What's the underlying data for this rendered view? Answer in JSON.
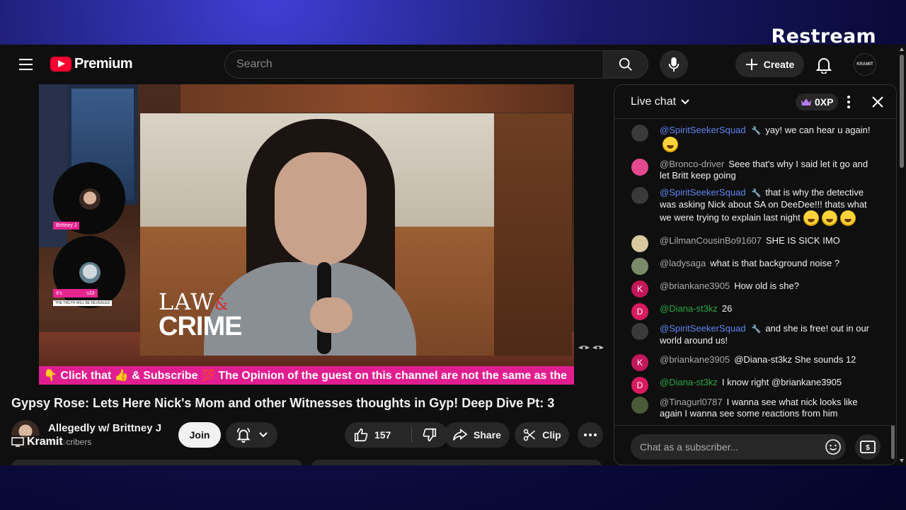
{
  "overlay": {
    "brand": "Restream"
  },
  "header": {
    "logo_text": "Premium",
    "search_placeholder": "Search",
    "create_label": "Create",
    "avatar_text": "KRAMIT"
  },
  "video": {
    "inset_logo_line1": "LAW",
    "inset_logo_amp": "&",
    "inset_logo_line2": "CRIME",
    "guest1_tag": "Brittney J",
    "guest2_tag": "It's ⠀⠀⠀⠀ ⠀⠀s33",
    "guest2_sub": "THE TRUTH WILL BE REVEALED",
    "ticker": "👇 Click that 👍 & Subscribe 💯 The Opinion of the guest on this channel are not the same as the"
  },
  "info": {
    "title": "Gypsy Rose: Lets Here Nick's Mom and other Witnesses thoughts in Gyp! Deep Dive Pt: 3",
    "channel_name": "Allegedly w/ Brittney J",
    "subscribers": "subscribers",
    "kramit_label": "Kramit",
    "join_label": "Join",
    "like_count": "157",
    "share_label": "Share",
    "clip_label": "Clip"
  },
  "chat": {
    "title": "Live chat",
    "xp": "0XP",
    "input_placeholder": "Chat as a subscriber...",
    "messages": [
      {
        "author": "@SpiritSeekerSquad",
        "text": "yay! we can hear u again!",
        "emojis": 1,
        "type": "mod",
        "avatar_color": "#3a3a3a",
        "avatar_letter": ""
      },
      {
        "author": "@Bronco-driver",
        "text": "Seee that's why I said let it go and let Britt keep going",
        "emojis": 0,
        "type": "normal",
        "avatar_color": "#e24a8d",
        "avatar_letter": ""
      },
      {
        "author": "@SpiritSeekerSquad",
        "text": "that is why the detective was asking Nick about SA on DeeDee!!! thats what we were trying to explain last night",
        "emojis": 3,
        "type": "mod",
        "avatar_color": "#3a3a3a",
        "avatar_letter": ""
      },
      {
        "author": "@LilmanCousinBo91607",
        "text": "SHE IS SICK IMO",
        "emojis": 0,
        "type": "normal",
        "avatar_color": "#d8c9a0",
        "avatar_letter": ""
      },
      {
        "author": "@ladysaga",
        "text": "what is that background noise ?",
        "emojis": 0,
        "type": "normal",
        "avatar_color": "#7a8a6a",
        "avatar_letter": ""
      },
      {
        "author": "@briankane3905",
        "text": "How old is she?",
        "emojis": 0,
        "type": "normal",
        "avatar_color": "#c2185b",
        "avatar_letter": "K"
      },
      {
        "author": "@Diana-st3kz",
        "text": "26",
        "emojis": 0,
        "type": "member",
        "avatar_color": "#d81b60",
        "avatar_letter": "D"
      },
      {
        "author": "@SpiritSeekerSquad",
        "text": "and she is free! out in our world around us!",
        "emojis": 0,
        "type": "mod",
        "avatar_color": "#3a3a3a",
        "avatar_letter": ""
      },
      {
        "author": "@briankane3905",
        "text": "@Diana-st3kz She sounds 12",
        "emojis": 0,
        "type": "normal",
        "avatar_color": "#c2185b",
        "avatar_letter": "K"
      },
      {
        "author": "@Diana-st3kz",
        "text": "I know right @briankane3905",
        "emojis": 0,
        "type": "member",
        "avatar_color": "#d81b60",
        "avatar_letter": "D"
      },
      {
        "author": "@Tinagurl0787",
        "text": "I wanna see what nick looks like again I wanna see some reactions from him",
        "emojis": 0,
        "type": "normal",
        "avatar_color": "#4a5a3a",
        "avatar_letter": ""
      }
    ]
  }
}
